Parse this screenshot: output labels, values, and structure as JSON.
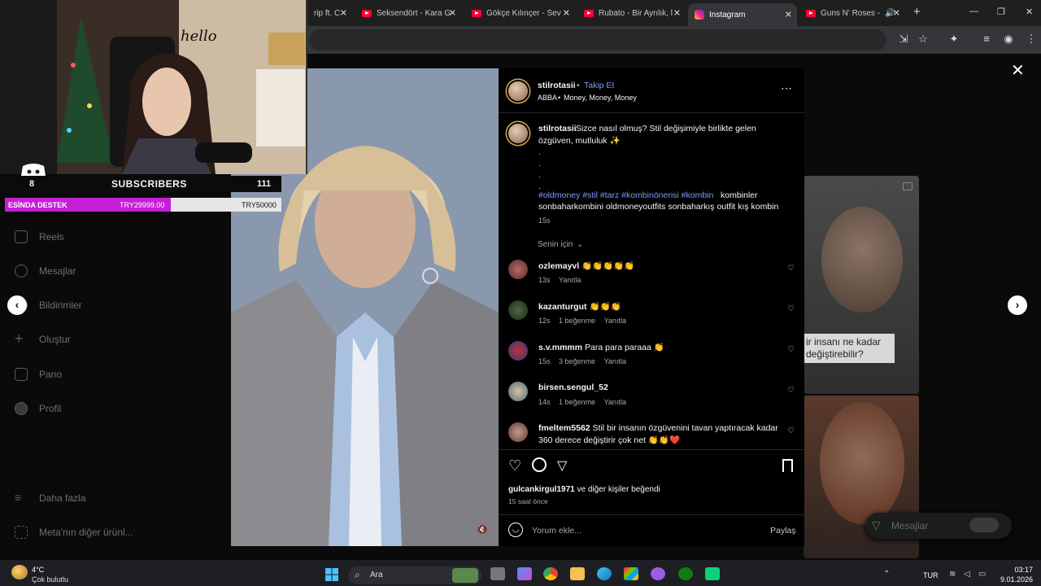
{
  "browser": {
    "tabs": [
      {
        "title": "rip ft. C",
        "type": "youtube"
      },
      {
        "title": "Seksendört - Kara G",
        "type": "youtube"
      },
      {
        "title": "Gökçe Kılınçer - Sev",
        "type": "youtube"
      },
      {
        "title": "Rubato - Bir Ayrılık, l",
        "type": "youtube"
      },
      {
        "title": "Instagram",
        "type": "instagram",
        "active": true
      },
      {
        "title": "Guns N' Roses -",
        "type": "youtube"
      }
    ],
    "new_tab": "+",
    "window_controls": [
      "—",
      "❐",
      "✕"
    ]
  },
  "stream_overlay": {
    "subs_count_left": "8",
    "subs_label": "SUBSCRIBERS",
    "subs_count_right": "111",
    "goal_label": "ESİNDA DESTEK",
    "goal_current": "TRY29999.00",
    "goal_target": "TRY50000",
    "goal_progress": 0.6,
    "accent": "#c51fd6"
  },
  "sidebar": {
    "items": [
      {
        "label": "Reels",
        "icon": "reels-icon"
      },
      {
        "label": "Mesajlar",
        "icon": "messenger-icon"
      },
      {
        "label": "Bildirimler",
        "icon": "heart-icon"
      },
      {
        "label": "Oluştur",
        "icon": "plus-icon"
      },
      {
        "label": "Pano",
        "icon": "dashboard-icon"
      },
      {
        "label": "Profil",
        "icon": "profile-icon"
      }
    ],
    "more": "Daha fazla",
    "meta": "Meta'nın diğer ürünl..."
  },
  "post": {
    "username": "stilrotasii",
    "follow": "Takip Et",
    "audio_artist": "ABBA",
    "audio_song": "Money, Money, Money",
    "caption_user": "stilrotasii",
    "caption_line1": "Sizce nasıl olmuş? Stil değişimiyle birlikte gelen",
    "caption_line2": "özgüven, mutluluk ✨",
    "hashtags": "#oldmoney #stil #tarz #kombinönerisi #kombin",
    "caption_tail1": "kombinler",
    "caption_tail2": "sonbaharkombini oldmoneyoutfits sonbaharkış outfit kış kombin",
    "caption_time": "15s",
    "sort_label": "Senin için",
    "comments": [
      {
        "user": "ozlemayvl",
        "text": "👏👏👏👏👏",
        "time": "13s",
        "likes": "",
        "reply": "Yanıtla"
      },
      {
        "user": "kazanturgut",
        "text": "👏👏👏",
        "time": "12s",
        "likes": "1 beğenme",
        "reply": "Yanıtla"
      },
      {
        "user": "s.v.mmmm",
        "text": "Para para paraaa 👏",
        "time": "15s",
        "likes": "3 beğenme",
        "reply": "Yanıtla"
      },
      {
        "user": "birsen.sengul_52",
        "text": "",
        "time": "14s",
        "likes": "1 beğenme",
        "reply": "Yanıtla"
      },
      {
        "user": "fmeltem5562",
        "text": "Stil bir insanın özgüvenini tavan yaptıracak kadar",
        "text2": "360 derece değiştirir çok net 👏👏❤️",
        "time": "",
        "likes": "",
        "reply": ""
      }
    ],
    "liked_by_user": "gulcankirgul1971",
    "liked_by_rest": "ve diğer kişiler beğendi",
    "post_time": "15 saat önce",
    "comment_placeholder": "Yorum ekle...",
    "share_label": "Paylaş"
  },
  "background_cards": {
    "card1_text_line1": "ir insanı ne kadar",
    "card1_text_line2": "değiştirebilir?",
    "messages_button": "Mesajlar"
  },
  "taskbar": {
    "weather_temp": "4°C",
    "weather_desc": "Çok bulutlu",
    "search_label": "Ara",
    "lang": "TUR",
    "time": "03:17",
    "date": "9.01.2026"
  }
}
